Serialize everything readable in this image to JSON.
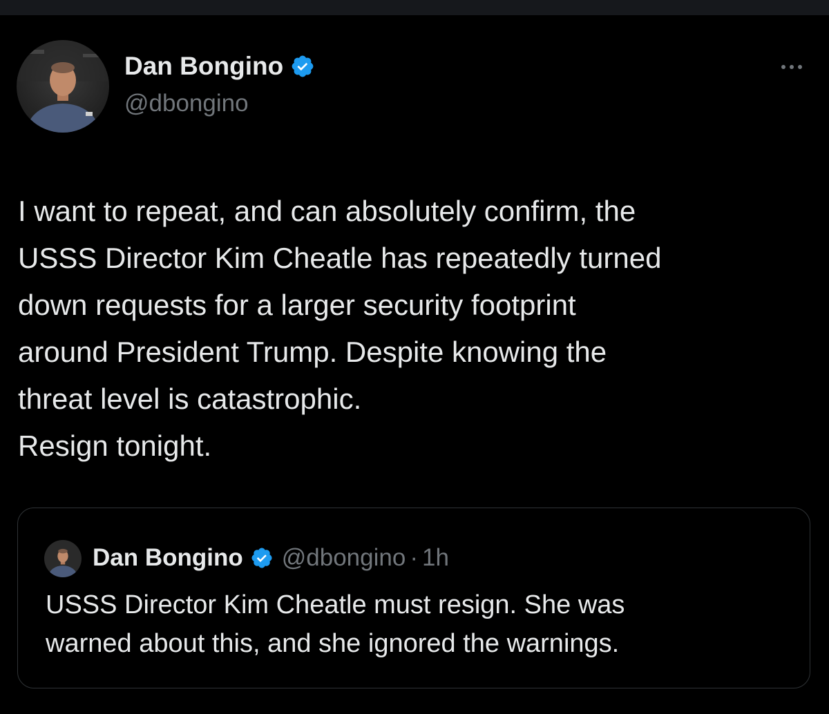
{
  "author": {
    "display_name": "Dan Bongino",
    "handle": "@dbongino",
    "verified_icon": "verified-badge-icon",
    "avatar_icon": "avatar-photo"
  },
  "menu": {
    "icon": "more-options-icon"
  },
  "tweet": {
    "lines": [
      "I want to repeat, and can absolutely confirm, the",
      "USSS Director Kim Cheatle has repeatedly turned",
      "down requests for a larger security footprint",
      "around President Trump. Despite knowing the",
      "threat level is catastrophic.",
      "Resign tonight."
    ]
  },
  "quoted_tweet": {
    "display_name": "Dan Bongino",
    "handle": "@dbongino",
    "separator": "·",
    "time": "1h",
    "lines": [
      "USSS Director Kim Cheatle must resign. She was",
      "warned about this, and she ignored the warnings."
    ]
  },
  "colors": {
    "background": "#000000",
    "text_primary": "#e7e9ea",
    "text_secondary": "#71767b",
    "verified_blue": "#1d9bf0",
    "border": "#2f3336"
  }
}
